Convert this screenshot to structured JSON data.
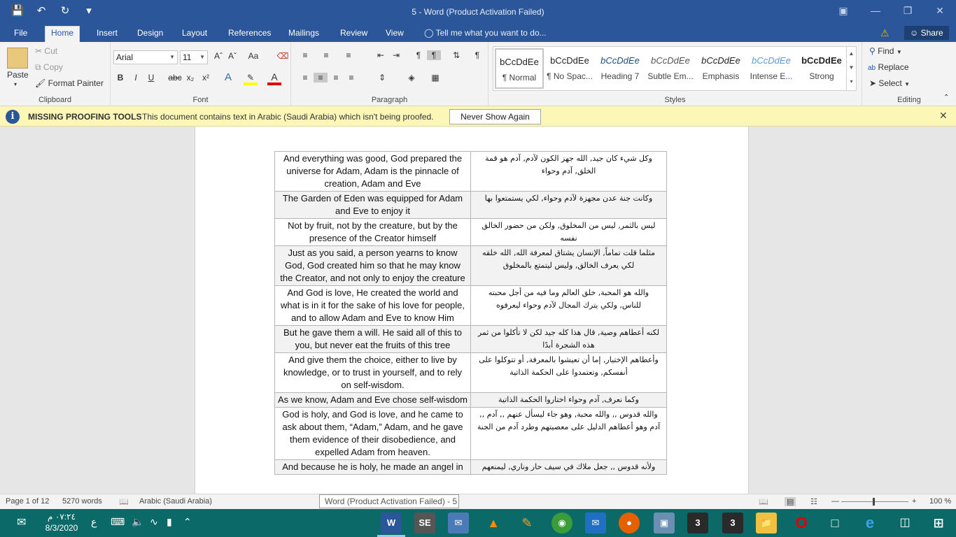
{
  "window": {
    "title": "5 - Word (Product Activation Failed)"
  },
  "tabs": [
    "File",
    "Home",
    "Insert",
    "Design",
    "Layout",
    "References",
    "Mailings",
    "Review",
    "View"
  ],
  "tell_me": "Tell me what you want to do...",
  "share": "Share",
  "clipboard": {
    "paste": "Paste",
    "cut": "Cut",
    "copy": "Copy",
    "format_painter": "Format Painter",
    "label": "Clipboard"
  },
  "font": {
    "name": "Arial",
    "size": "11",
    "label": "Font"
  },
  "paragraph": {
    "label": "Paragraph"
  },
  "styles": {
    "label": "Styles",
    "items": [
      {
        "preview": "bCcDdEe",
        "name": "¶ Normal"
      },
      {
        "preview": "bCcDdEe",
        "name": "¶ No Spac..."
      },
      {
        "preview": "bCcDdEe",
        "name": "Heading 7"
      },
      {
        "preview": "bCcDdEe",
        "name": "Subtle Em..."
      },
      {
        "preview": "bCcDdEe",
        "name": "Emphasis"
      },
      {
        "preview": "bCcDdEe",
        "name": "Intense E..."
      },
      {
        "preview": "bCcDdEe",
        "name": "Strong"
      }
    ]
  },
  "editing": {
    "find": "Find",
    "replace": "Replace",
    "select": "Select",
    "label": "Editing"
  },
  "message_bar": {
    "heading": "MISSING PROOFING TOOLS",
    "text": "This document contains text in Arabic (Saudi Arabia) which isn't being proofed.",
    "button": "Never Show Again"
  },
  "table_rows": [
    {
      "en": "And everything was good, God prepared the universe for Adam, Adam is the pinnacle of creation, Adam and Eve",
      "ar": "وكل شيء كان جيد, الله جهز الكون لآدم, آدم هو قمة الخلق, آدم وحواء"
    },
    {
      "en": "The Garden of Eden was equipped for Adam and Eve to enjoy it",
      "ar": "وكانت جنة عدن مجهزة لآدم وحواء, لكي يستمتعوا بها"
    },
    {
      "en": "Not by fruit, not by the creature, but by the presence of the Creator himself",
      "ar": "ليس بالثمر, ليس من المخلوق, ولكن من حضور الخالق نفسه"
    },
    {
      "en": "Just as you said, a person yearns to know God, God created him so that he may know the Creator, and not only to enjoy the creature",
      "ar": "مثلما قلت تماماً, الإنسان يشتاق لمعرفة الله, الله خلقه لكي يعرف الخالق, وليس ليتمتع بالمخلوق"
    },
    {
      "en": "And God is love, He created the world and what is in it for the sake of his love for people, and to allow Adam and Eve to know Him",
      "ar": "والله هو المحبة, خلق العالم وما فيه من أجل محبته للناس, ولكي يترك المجال لآدم وحواء ليعرفوه"
    },
    {
      "en": "But he gave them a will. He said all of this to you, but never eat the fruits of this tree",
      "ar": "لكنه أعطاهم وصية, قال هذا كله جيد لكن لا تأكلوا من ثمر هذه الشجرة أبدًا"
    },
    {
      "en": "And give them the choice, either to live by knowledge, or to trust in yourself, and to rely on self-wisdom.",
      "ar": "وأعطاهم الإختيار, إما أن تعيشوا بالمعرفة, أو تتوكلوا على أنفسكم, وتعتمدوا على الحكمة الذاتية"
    },
    {
      "en": "As we know, Adam and Eve chose self-wisdom",
      "ar": "وكما نعرف, آدم وحواء اختاروا الحكمة الذاتية"
    },
    {
      "en": "God is holy, and God is love, and he came to ask about them, “Adam,” Adam, and he gave them evidence of their disobedience, and expelled Adam from heaven.",
      "ar": "والله قدوس ,, والله محبة, وهو جاء ليسأل عنهم ,, آدم ,, آدم وهو أعطاهم الدليل على معصيتهم وطرد آدم من الجنة"
    },
    {
      "en": "And because he is holy, he made an angel in",
      "ar": "ولأنه قدوس ,, جعل ملاك في سيف حار وناري, ليمنعهم"
    }
  ],
  "status": {
    "page": "Page 1 of 12",
    "words": "5270 words",
    "language": "Arabic (Saudi Arabia)",
    "tooltip": "Word (Product Activation Failed) - 5",
    "zoom": "100 %"
  },
  "taskbar": {
    "time": "٠٧:٢٤ م",
    "date": "8/3/2020",
    "lang": "ع"
  }
}
